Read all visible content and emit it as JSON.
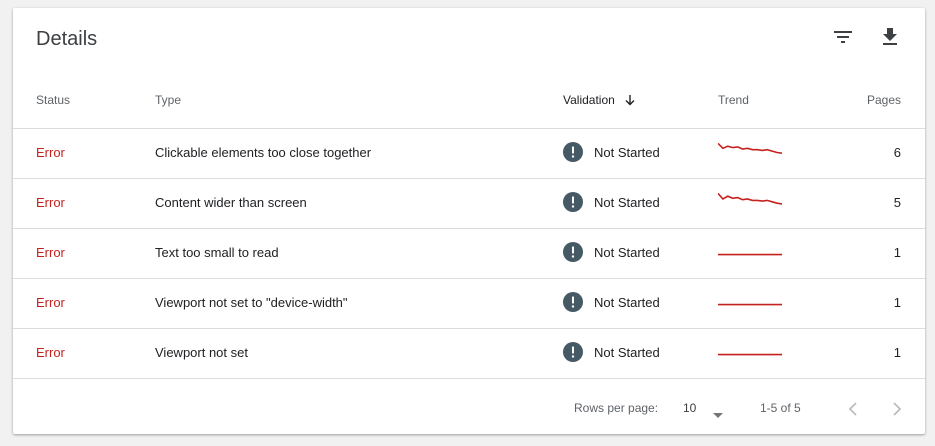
{
  "card": {
    "title": "Details"
  },
  "toolbar": {
    "filter_icon": "filter-icon",
    "download_icon": "download-icon"
  },
  "columns": {
    "status": "Status",
    "type": "Type",
    "validation": "Validation",
    "trend": "Trend",
    "pages": "Pages"
  },
  "colors": {
    "error": "#c5221f",
    "trend_line": "#c5221f",
    "validation_icon": "#455a64"
  },
  "rows": [
    {
      "status": "Error",
      "type": "Clickable elements too close together",
      "validation": "Not Started",
      "trend": [
        0.9,
        0.55,
        0.7,
        0.6,
        0.65,
        0.5,
        0.55,
        0.45,
        0.45,
        0.4,
        0.45,
        0.35,
        0.25,
        0.2
      ],
      "pages": "6"
    },
    {
      "status": "Error",
      "type": "Content wider than screen",
      "validation": "Not Started",
      "trend": [
        0.9,
        0.5,
        0.7,
        0.55,
        0.6,
        0.45,
        0.5,
        0.4,
        0.4,
        0.35,
        0.4,
        0.3,
        0.2,
        0.15
      ],
      "pages": "5"
    },
    {
      "status": "Error",
      "type": "Text too small to read",
      "validation": "Not Started",
      "trend": [
        0.1,
        0.1,
        0.1,
        0.1,
        0.1,
        0.1,
        0.1,
        0.1,
        0.1,
        0.1,
        0.1,
        0.1,
        0.1,
        0.1
      ],
      "pages": "1"
    },
    {
      "status": "Error",
      "type": "Viewport not set to \"device-width\"",
      "validation": "Not Started",
      "trend": [
        0.1,
        0.1,
        0.1,
        0.1,
        0.1,
        0.1,
        0.1,
        0.1,
        0.1,
        0.1,
        0.1,
        0.1,
        0.1,
        0.1
      ],
      "pages": "1"
    },
    {
      "status": "Error",
      "type": "Viewport not set",
      "validation": "Not Started",
      "trend": [
        0.1,
        0.1,
        0.1,
        0.1,
        0.1,
        0.1,
        0.1,
        0.1,
        0.1,
        0.1,
        0.1,
        0.1,
        0.1,
        0.1
      ],
      "pages": "1"
    }
  ],
  "pagination": {
    "rows_per_page_label": "Rows per page:",
    "rows_per_page": "10",
    "range": "1-5 of 5"
  }
}
